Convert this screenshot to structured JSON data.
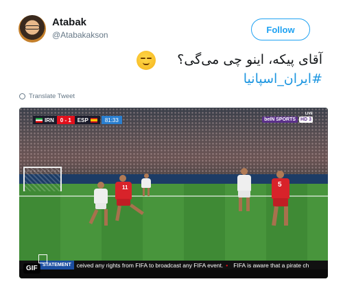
{
  "tweet": {
    "author_name": "Atabak",
    "author_handle": "@Atabakakson",
    "follow_label": "Follow",
    "text_line1": "آقای پیکه، اینو چی می‌گی؟",
    "hashtag": "#ایران_اسپانیا",
    "translate_label": "Translate Tweet",
    "emoji_icon": "smirking-face-icon"
  },
  "media": {
    "gif_label": "GIF",
    "scorebug": {
      "home_team": "IRN",
      "away_team": "ESP",
      "score": "0 - 1",
      "clock": "81:33"
    },
    "broadcaster": {
      "name": "beIN SPORTS",
      "channel": "HD 3",
      "live_label": "LIVE"
    },
    "ticker": {
      "label": "STATEMENT",
      "message": "ceived any rights from FIFA to broadcast any FIFA event.",
      "message2": "FIFA is aware that a pirate ch"
    },
    "player_number": "5",
    "player_number2": "11"
  },
  "colors": {
    "accent": "#1da1f2",
    "hashtag": "#1b95e0",
    "iran_kit": "#d8232a",
    "spain_kit": "#f2f2f2"
  }
}
